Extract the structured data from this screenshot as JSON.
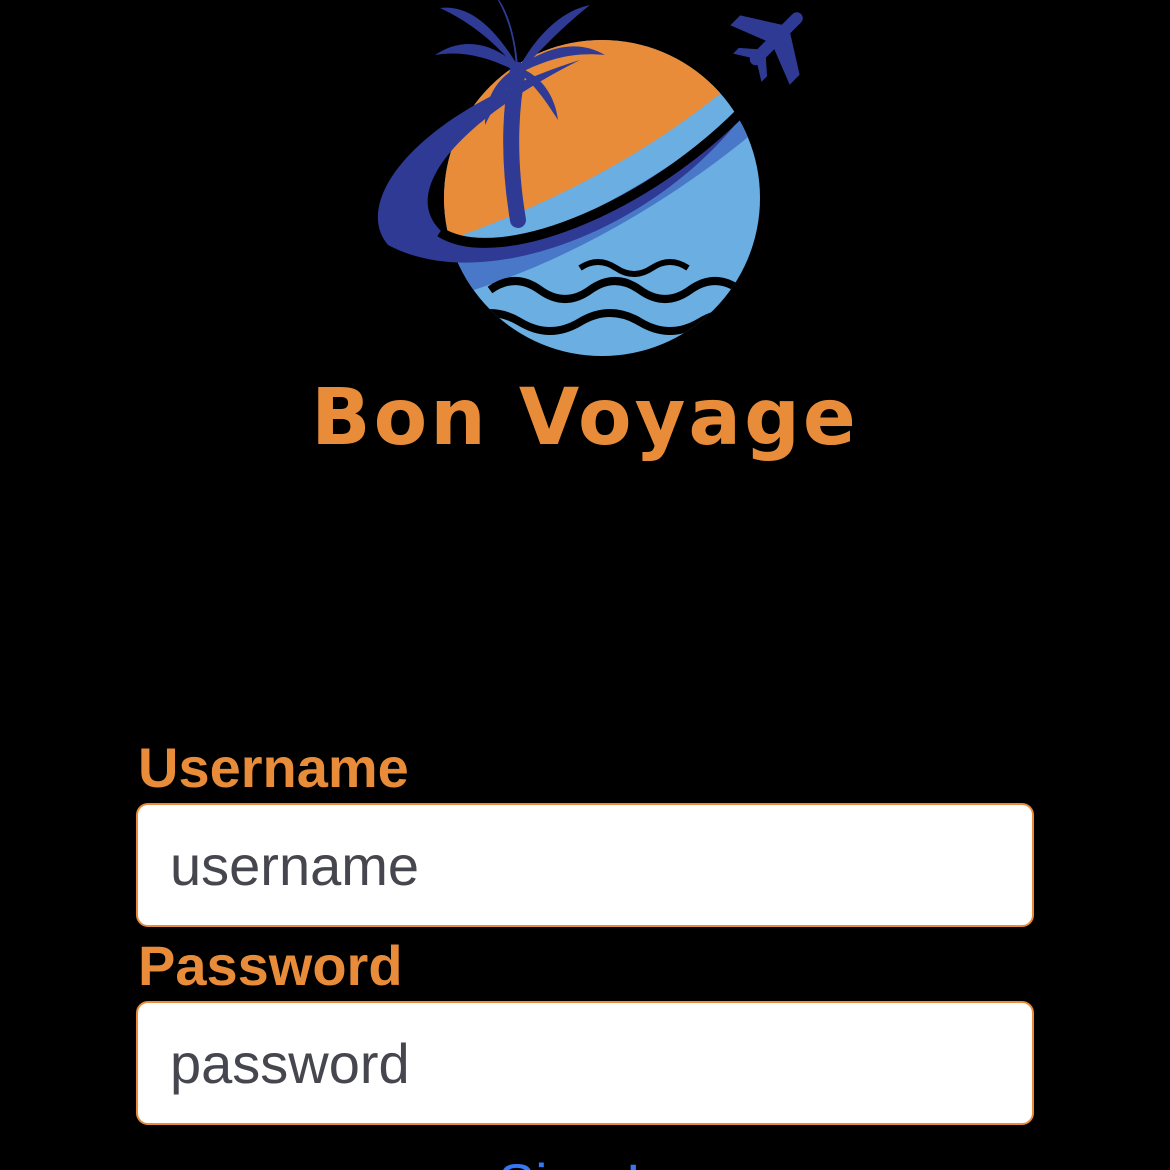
{
  "brand": {
    "name": "Bon Voyage",
    "logo_icon": "travel-globe-palm-airplane-logo"
  },
  "form": {
    "username_label": "Username",
    "username_placeholder": "username",
    "username_value": "",
    "password_label": "Password",
    "password_placeholder": "password",
    "password_value": "",
    "submit_label": "Sign In"
  },
  "colors": {
    "background": "#000000",
    "accent_orange": "#E88C3A",
    "navy": "#2E3A94",
    "sky_blue": "#6AAEE2",
    "link_blue": "#3478F6",
    "field_bg": "#FFFFFF",
    "field_text": "#46464E"
  }
}
